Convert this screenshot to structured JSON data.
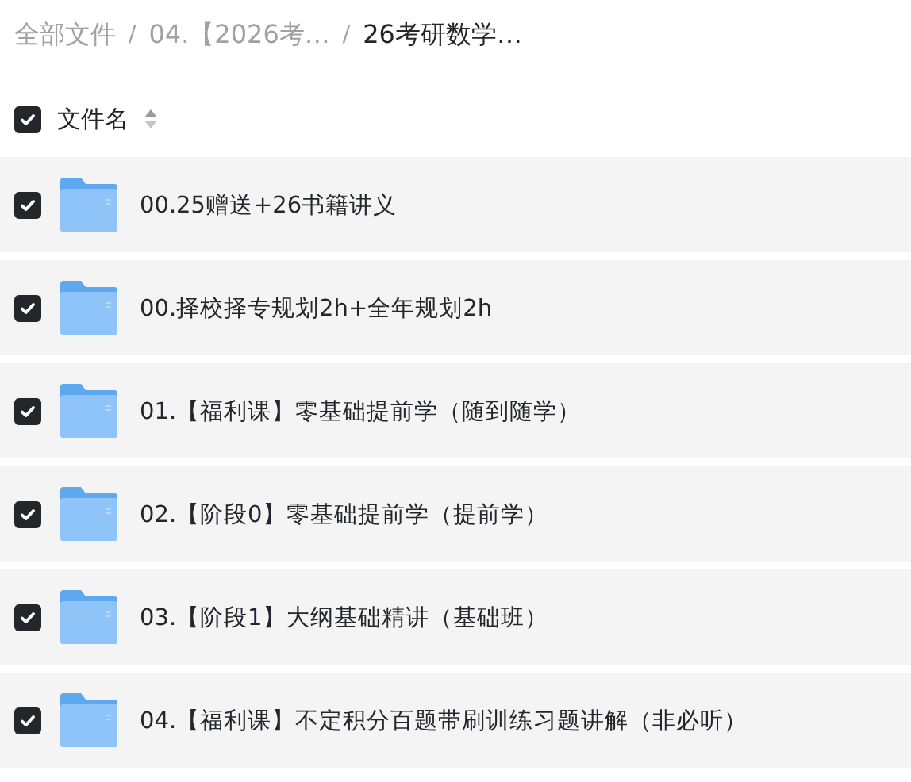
{
  "breadcrumb_separators": [
    "/",
    "/"
  ],
  "breadcrumb": [
    {
      "label": "全部文件",
      "current": false
    },
    {
      "label": "04.【2026考…",
      "current": false
    },
    {
      "label": "26考研数学…",
      "current": true
    }
  ],
  "header": {
    "label": "文件名",
    "checked": true
  },
  "files": [
    {
      "name": "00.25赠送+26书籍讲义",
      "checked": true
    },
    {
      "name": "00.择校择专规划2h+全年规划2h",
      "checked": true
    },
    {
      "name": "01.【福利课】零基础提前学（随到随学）",
      "checked": true
    },
    {
      "name": "02.【阶段0】零基础提前学（提前学）",
      "checked": true
    },
    {
      "name": "03.【阶段1】大纲基础精讲（基础班）",
      "checked": true
    },
    {
      "name": "04.【福利课】不定积分百题带刷训练习题讲解（非必听）",
      "checked": true
    }
  ]
}
